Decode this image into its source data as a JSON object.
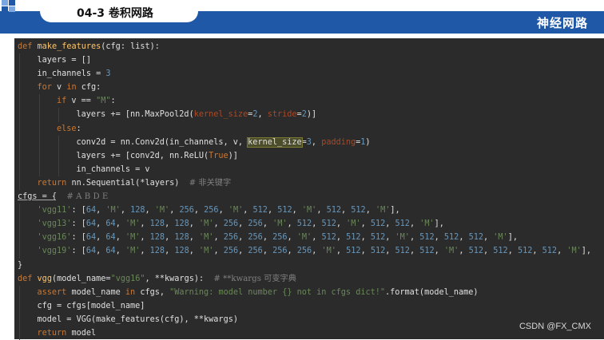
{
  "header": {
    "title": "04-3 卷积网路",
    "brand": "神经网路",
    "accent": "#1f58a7"
  },
  "code_lines": [
    [
      [
        "kw",
        "def "
      ],
      [
        "fn",
        "make_features"
      ],
      [
        "t",
        "(cfg: list):"
      ]
    ],
    [
      [
        "t",
        "layers = []"
      ]
    ],
    [
      [
        "t",
        "in_channels = "
      ],
      [
        "num",
        "3"
      ]
    ],
    [
      [
        "kw",
        "for "
      ],
      [
        "t",
        "v "
      ],
      [
        "kw",
        "in "
      ],
      [
        "t",
        "cfg:"
      ]
    ],
    [
      [
        "kw",
        "if "
      ],
      [
        "t",
        "v == "
      ],
      [
        "str",
        "\"M\""
      ],
      [
        "t",
        ":"
      ]
    ],
    [
      [
        "t",
        "layers += [nn.MaxPool2d("
      ],
      [
        "param",
        "kernel_size"
      ],
      [
        "t",
        "="
      ],
      [
        "num",
        "2"
      ],
      [
        "t",
        ", "
      ],
      [
        "param",
        "stride"
      ],
      [
        "t",
        "="
      ],
      [
        "num",
        "2"
      ],
      [
        "t",
        ")]"
      ]
    ],
    [
      [
        "kw",
        "else"
      ],
      [
        "t",
        ":"
      ]
    ],
    [
      [
        "t",
        "conv2d = nn.Conv2d(in_channels, v, "
      ],
      [
        "hl",
        "kernel_size"
      ],
      [
        "t",
        "="
      ],
      [
        "num",
        "3"
      ],
      [
        "t",
        ", "
      ],
      [
        "param",
        "padding"
      ],
      [
        "t",
        "="
      ],
      [
        "num",
        "1"
      ],
      [
        "t",
        ")"
      ]
    ],
    [
      [
        "t",
        "layers += [conv2d, nn.ReLU("
      ],
      [
        "kw",
        "True"
      ],
      [
        "t",
        ")]"
      ]
    ],
    [
      [
        "t",
        "in_channels = v"
      ]
    ],
    [
      [
        "kw",
        "return "
      ],
      [
        "t",
        "nn.Sequential(*layers)  "
      ],
      [
        "cm",
        "# 非关键字"
      ]
    ],
    [
      [
        "ul",
        "cfgs = {"
      ],
      [
        "t",
        "  "
      ],
      [
        "cm",
        "# A B D E"
      ]
    ],
    [
      [
        "str",
        "'vgg11'"
      ],
      [
        "t",
        ": ["
      ],
      [
        "num",
        "64"
      ],
      [
        "t",
        ", "
      ],
      [
        "str",
        "'M'"
      ],
      [
        "t",
        ", "
      ],
      [
        "num",
        "128"
      ],
      [
        "t",
        ", "
      ],
      [
        "str",
        "'M'"
      ],
      [
        "t",
        ", "
      ],
      [
        "num",
        "256"
      ],
      [
        "t",
        ", "
      ],
      [
        "num",
        "256"
      ],
      [
        "t",
        ", "
      ],
      [
        "str",
        "'M'"
      ],
      [
        "t",
        ", "
      ],
      [
        "num",
        "512"
      ],
      [
        "t",
        ", "
      ],
      [
        "num",
        "512"
      ],
      [
        "t",
        ", "
      ],
      [
        "str",
        "'M'"
      ],
      [
        "t",
        ", "
      ],
      [
        "num",
        "512"
      ],
      [
        "t",
        ", "
      ],
      [
        "num",
        "512"
      ],
      [
        "t",
        ", "
      ],
      [
        "str",
        "'M'"
      ],
      [
        "t",
        "],"
      ]
    ],
    [
      [
        "str",
        "'vgg13'"
      ],
      [
        "t",
        ": ["
      ],
      [
        "num",
        "64"
      ],
      [
        "t",
        ", "
      ],
      [
        "num",
        "64"
      ],
      [
        "t",
        ", "
      ],
      [
        "str",
        "'M'"
      ],
      [
        "t",
        ", "
      ],
      [
        "num",
        "128"
      ],
      [
        "t",
        ", "
      ],
      [
        "num",
        "128"
      ],
      [
        "t",
        ", "
      ],
      [
        "str",
        "'M'"
      ],
      [
        "t",
        ", "
      ],
      [
        "num",
        "256"
      ],
      [
        "t",
        ", "
      ],
      [
        "num",
        "256"
      ],
      [
        "t",
        ", "
      ],
      [
        "str",
        "'M'"
      ],
      [
        "t",
        ", "
      ],
      [
        "num",
        "512"
      ],
      [
        "t",
        ", "
      ],
      [
        "num",
        "512"
      ],
      [
        "t",
        ", "
      ],
      [
        "str",
        "'M'"
      ],
      [
        "t",
        ", "
      ],
      [
        "num",
        "512"
      ],
      [
        "t",
        ", "
      ],
      [
        "num",
        "512"
      ],
      [
        "t",
        ", "
      ],
      [
        "str",
        "'M'"
      ],
      [
        "t",
        "],"
      ]
    ],
    [
      [
        "str",
        "'vgg16'"
      ],
      [
        "t",
        ": ["
      ],
      [
        "num",
        "64"
      ],
      [
        "t",
        ", "
      ],
      [
        "num",
        "64"
      ],
      [
        "t",
        ", "
      ],
      [
        "str",
        "'M'"
      ],
      [
        "t",
        ", "
      ],
      [
        "num",
        "128"
      ],
      [
        "t",
        ", "
      ],
      [
        "num",
        "128"
      ],
      [
        "t",
        ", "
      ],
      [
        "str",
        "'M'"
      ],
      [
        "t",
        ", "
      ],
      [
        "num",
        "256"
      ],
      [
        "t",
        ", "
      ],
      [
        "num",
        "256"
      ],
      [
        "t",
        ", "
      ],
      [
        "num",
        "256"
      ],
      [
        "t",
        ", "
      ],
      [
        "str",
        "'M'"
      ],
      [
        "t",
        ", "
      ],
      [
        "num",
        "512"
      ],
      [
        "t",
        ", "
      ],
      [
        "num",
        "512"
      ],
      [
        "t",
        ", "
      ],
      [
        "num",
        "512"
      ],
      [
        "t",
        ", "
      ],
      [
        "str",
        "'M'"
      ],
      [
        "t",
        ", "
      ],
      [
        "num",
        "512"
      ],
      [
        "t",
        ", "
      ],
      [
        "num",
        "512"
      ],
      [
        "t",
        ", "
      ],
      [
        "num",
        "512"
      ],
      [
        "t",
        ", "
      ],
      [
        "str",
        "'M'"
      ],
      [
        "t",
        "],"
      ]
    ],
    [
      [
        "str",
        "'vgg19'"
      ],
      [
        "t",
        ": ["
      ],
      [
        "num",
        "64"
      ],
      [
        "t",
        ", "
      ],
      [
        "num",
        "64"
      ],
      [
        "t",
        ", "
      ],
      [
        "str",
        "'M'"
      ],
      [
        "t",
        ", "
      ],
      [
        "num",
        "128"
      ],
      [
        "t",
        ", "
      ],
      [
        "num",
        "128"
      ],
      [
        "t",
        ", "
      ],
      [
        "str",
        "'M'"
      ],
      [
        "t",
        ", "
      ],
      [
        "num",
        "256"
      ],
      [
        "t",
        ", "
      ],
      [
        "num",
        "256"
      ],
      [
        "t",
        ", "
      ],
      [
        "num",
        "256"
      ],
      [
        "t",
        ", "
      ],
      [
        "num",
        "256"
      ],
      [
        "t",
        ", "
      ],
      [
        "str",
        "'M'"
      ],
      [
        "t",
        ", "
      ],
      [
        "num",
        "512"
      ],
      [
        "t",
        ", "
      ],
      [
        "num",
        "512"
      ],
      [
        "t",
        ", "
      ],
      [
        "num",
        "512"
      ],
      [
        "t",
        ", "
      ],
      [
        "num",
        "512"
      ],
      [
        "t",
        ", "
      ],
      [
        "str",
        "'M'"
      ],
      [
        "t",
        ", "
      ],
      [
        "num",
        "512"
      ],
      [
        "t",
        ", "
      ],
      [
        "num",
        "512"
      ],
      [
        "t",
        ", "
      ],
      [
        "num",
        "512"
      ],
      [
        "t",
        ", "
      ],
      [
        "num",
        "512"
      ],
      [
        "t",
        ", "
      ],
      [
        "str",
        "'M'"
      ],
      [
        "t",
        "],"
      ]
    ],
    [
      [
        "t",
        "}"
      ]
    ],
    [
      [
        "kw",
        "def "
      ],
      [
        "fn",
        "vgg"
      ],
      [
        "t",
        "(model_name="
      ],
      [
        "str",
        "\"vgg16\""
      ],
      [
        "t",
        ", **kwargs):  "
      ],
      [
        "cm",
        "# **kwargs 可变字典"
      ]
    ],
    [
      [
        "kw",
        "assert "
      ],
      [
        "t",
        "model_name "
      ],
      [
        "kw",
        "in "
      ],
      [
        "t",
        "cfgs, "
      ],
      [
        "str",
        "\"Warning: model number {} not in cfgs dict!\""
      ],
      [
        "t",
        ".format(model_name)"
      ]
    ],
    [
      [
        "t",
        "cfg = cfgs[model_name]"
      ]
    ],
    [
      [
        "t",
        "model = VGG(make_features(cfg), **kwargs)"
      ]
    ],
    [
      [
        "kw",
        "return "
      ],
      [
        "t",
        "model"
      ]
    ]
  ],
  "watermark": "CSDN @FX_CMX"
}
